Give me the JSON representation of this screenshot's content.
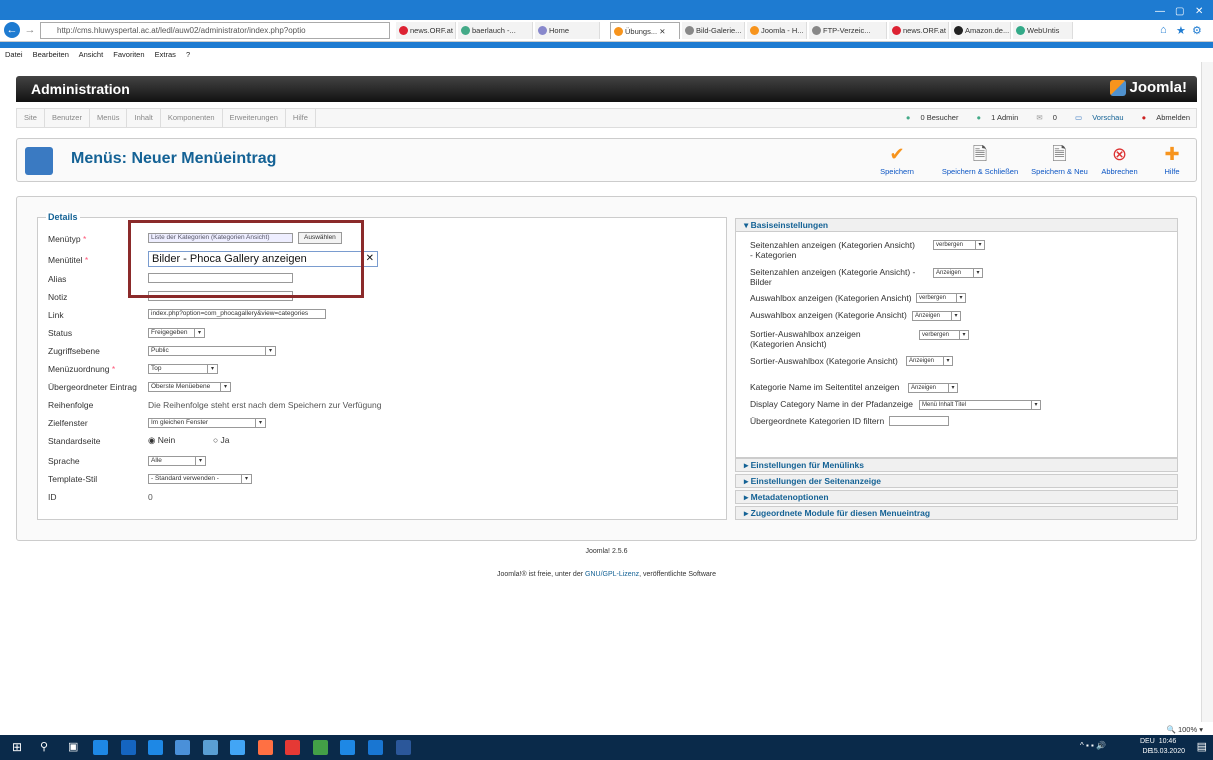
{
  "browser": {
    "url": "http://cms.hluwyspertal.ac.at/ledl/auw02/administrator/index.php?optio",
    "tabs": [
      {
        "label": "news.ORF.at",
        "color": "#d23"
      },
      {
        "label": "baerlauch -...",
        "color": "#4a8"
      },
      {
        "label": "Home",
        "color": "#88c"
      },
      {
        "label": "Übungs...",
        "color": "#f7941d"
      },
      {
        "label": "Bild-Galerie...",
        "color": "#888"
      },
      {
        "label": "Joomla - H...",
        "color": "#f7941d"
      },
      {
        "label": "FTP-Verzeic...",
        "color": "#888"
      },
      {
        "label": "news.ORF.at",
        "color": "#d23"
      },
      {
        "label": "Amazon.de...",
        "color": "#222"
      },
      {
        "label": "WebUntis",
        "color": "#3a8"
      }
    ],
    "menu": [
      "Datei",
      "Bearbeiten",
      "Ansicht",
      "Favoriten",
      "Extras",
      "?"
    ],
    "zoom": "100%"
  },
  "admin": {
    "title": "Administration",
    "logo": "Joomla!",
    "nav": [
      "Site",
      "Benutzer",
      "Menüs",
      "Inhalt",
      "Komponenten",
      "Erweiterungen",
      "Hilfe"
    ],
    "status": {
      "visitors": "0 Besucher",
      "admins": "1 Admin",
      "messages": "0",
      "preview": "Vorschau",
      "logout": "Abmelden"
    }
  },
  "toolbar": {
    "title": "Menüs: Neuer Menüeintrag",
    "save": "Speichern",
    "save_close": "Speichern & Schließen",
    "save_new": "Speichern & Neu",
    "cancel": "Abbrechen",
    "help": "Hilfe"
  },
  "details": {
    "legend": "Details",
    "menutype_label": "Menütyp",
    "menutype_value": "Liste der Kategorien (Kategorien Ansicht)",
    "select_button": "Auswählen",
    "title_label": "Menütitel",
    "title_value": "Bilder - Phoca Gallery anzeigen",
    "alias_label": "Alias",
    "note_label": "Notiz",
    "link_label": "Link",
    "link_value": "index.php?option=com_phocagallery&view=categories",
    "status_label": "Status",
    "status_value": "Freigegeben",
    "access_label": "Zugriffsebene",
    "access_value": "Public",
    "menu_label": "Menüzuordnung",
    "menu_value": "Top",
    "parent_label": "Übergeordneter Eintrag",
    "parent_value": "Oberste Menüebene",
    "order_label": "Reihenfolge",
    "order_value": "Die Reihenfolge steht erst nach dem Speichern zur Verfügung",
    "target_label": "Zielfenster",
    "target_value": "Im gleichen Fenster",
    "home_label": "Standardseite",
    "home_no": "Nein",
    "home_yes": "Ja",
    "lang_label": "Sprache",
    "lang_value": "Alle",
    "style_label": "Template-Stil",
    "style_value": "- Standard verwenden -",
    "id_label": "ID",
    "id_value": "0"
  },
  "basic": {
    "header": "Basiseinstellungen",
    "rows": [
      {
        "label": "Seitenzahlen anzeigen (Kategorien Ansicht) - Kategorien",
        "value": "verbergen"
      },
      {
        "label": "Seitenzahlen anzeigen (Kategorie Ansicht) - Bilder",
        "value": "Anzeigen"
      },
      {
        "label": "Auswahlbox anzeigen (Kategorien Ansicht)",
        "value": "verbergen"
      },
      {
        "label": "Auswahlbox anzeigen (Kategorie Ansicht)",
        "value": "Anzeigen"
      },
      {
        "label": "Sortier-Auswahlbox anzeigen (Kategorien Ansicht)",
        "value": "verbergen"
      },
      {
        "label": "Sortier-Auswahlbox (Kategorie Ansicht)",
        "value": "Anzeigen"
      },
      {
        "label": "Kategorie Name im Seitentitel anzeigen",
        "value": "Anzeigen"
      },
      {
        "label": "Display Category Name in der Pfadanzeige",
        "value": "Menü Inhalt Titel"
      },
      {
        "label": "Übergeordnete Kategorien ID filtern",
        "value": ""
      }
    ],
    "collapsed": [
      "Einstellungen für Menülinks",
      "Einstellungen der Seitenanzeige",
      "Metadatenoptionen",
      "Zugeordnete Module für diesen Menueintrag"
    ]
  },
  "footer": {
    "version": "Joomla! 2.5.6",
    "license_prefix": "Joomla!® ist freie, unter der",
    "license_link": "GNU/GPL-Lizenz",
    "license_suffix": "veröffentlichte Software"
  },
  "taskbar": {
    "lang": "DEU",
    "lang2": "DE",
    "time": "10:46",
    "date": "15.03.2020"
  }
}
